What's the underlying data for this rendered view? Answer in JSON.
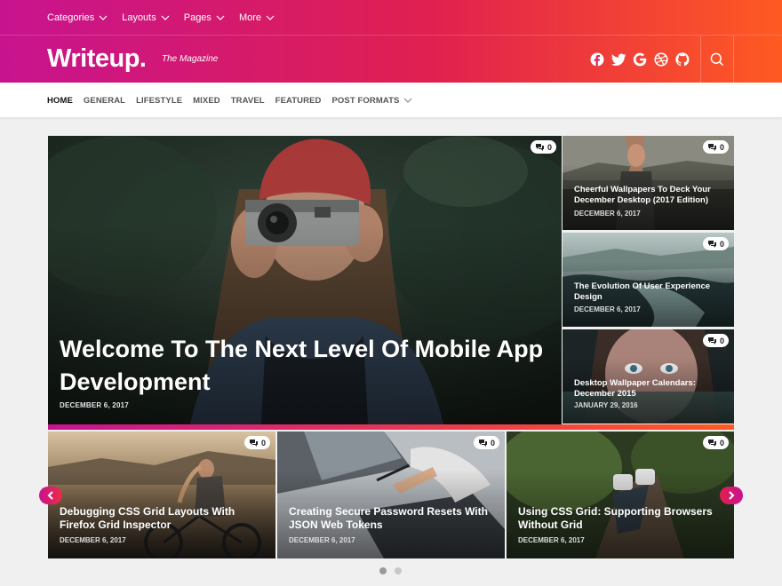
{
  "topnav": {
    "items": [
      {
        "label": "Categories"
      },
      {
        "label": "Layouts"
      },
      {
        "label": "Pages"
      },
      {
        "label": "More"
      }
    ]
  },
  "brand": {
    "logo": "Writeup.",
    "tagline": "The Magazine"
  },
  "social_icons": [
    "facebook-icon",
    "twitter-icon",
    "google-icon",
    "dribbble-icon",
    "github-icon"
  ],
  "mainnav": {
    "items": [
      {
        "label": "HOME",
        "active": true
      },
      {
        "label": "GENERAL"
      },
      {
        "label": "LIFESTYLE"
      },
      {
        "label": "MIXED"
      },
      {
        "label": "TRAVEL"
      },
      {
        "label": "FEATURED"
      },
      {
        "label": "POST FORMATS"
      }
    ]
  },
  "hero": {
    "title": "Welcome To The Next Level Of Mobile App Development",
    "date": "DECEMBER 6, 2017",
    "comments": "0"
  },
  "side_posts": [
    {
      "title": "Cheerful Wallpapers To Deck Your December Desktop (2017 Edition)",
      "date": "DECEMBER 6, 2017",
      "comments": "0"
    },
    {
      "title": "The Evolution Of User Experience Design",
      "date": "DECEMBER 6, 2017",
      "comments": "0"
    },
    {
      "title": "Desktop Wallpaper Calendars: December 2015",
      "date": "JANUARY 29, 2016",
      "comments": "0"
    }
  ],
  "bottom_posts": [
    {
      "title": "Debugging CSS Grid Layouts With Firefox Grid Inspector",
      "date": "DECEMBER 6, 2017",
      "comments": "0"
    },
    {
      "title": "Creating Secure Password Resets With JSON Web Tokens",
      "date": "DECEMBER 6, 2017",
      "comments": "0"
    },
    {
      "title": "Using CSS Grid: Supporting Browsers Without Grid",
      "date": "DECEMBER 6, 2017",
      "comments": "0"
    }
  ],
  "colors": {
    "brand_start": "#c8138f",
    "brand_mid": "#e0204f",
    "brand_end": "#ff5a22"
  }
}
